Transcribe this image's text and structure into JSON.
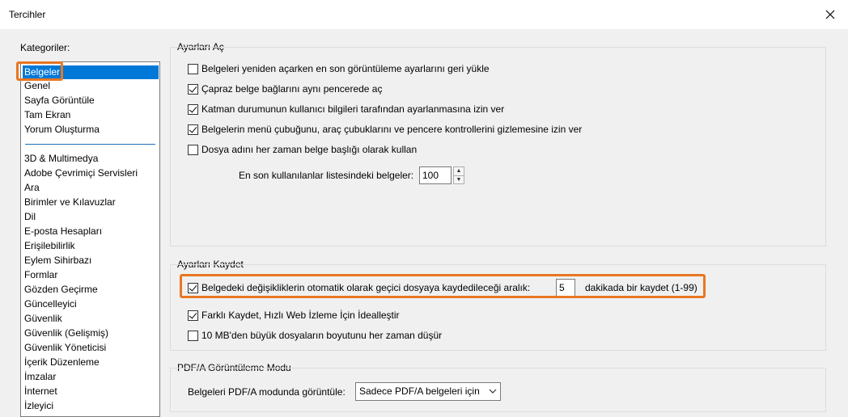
{
  "window": {
    "title": "Tercihler"
  },
  "sidebar": {
    "label": "Kategoriler:",
    "items": [
      {
        "label": "Belgeler",
        "selected": true
      },
      {
        "label": "Genel"
      },
      {
        "label": "Sayfa Görüntüle"
      },
      {
        "label": "Tam Ekran"
      },
      {
        "label": "Yorum Oluşturma"
      },
      {
        "label": "3D & Multimedya"
      },
      {
        "label": "Adobe Çevrimiçi Servisleri"
      },
      {
        "label": "Ara"
      },
      {
        "label": "Birimler ve Kılavuzlar"
      },
      {
        "label": "Dil"
      },
      {
        "label": "E-posta Hesapları"
      },
      {
        "label": "Erişilebilirlik"
      },
      {
        "label": "Eylem Sihirbazı"
      },
      {
        "label": "Formlar"
      },
      {
        "label": "Gözden Geçirme"
      },
      {
        "label": "Güncelleyici"
      },
      {
        "label": "Güvenlik"
      },
      {
        "label": "Güvenlik (Gelişmiş)"
      },
      {
        "label": "Güvenlik Yöneticisi"
      },
      {
        "label": "İçerik Düzenleme"
      },
      {
        "label": "İmzalar"
      },
      {
        "label": "İnternet"
      },
      {
        "label": "İzleyici"
      }
    ]
  },
  "open_settings": {
    "title": "Ayarları Aç",
    "options": [
      {
        "label": "Belgeleri yeniden açarken en son görüntüleme ayarlarını geri yükle",
        "checked": false
      },
      {
        "label": "Çapraz belge bağlarını aynı pencerede aç",
        "checked": true
      },
      {
        "label": "Katman durumunun kullanıcı bilgileri tarafından ayarlanmasına izin ver",
        "checked": true
      },
      {
        "label": "Belgelerin menü çubuğunu, araç çubuklarını ve pencere kontrollerini gizlemesine izin ver",
        "checked": true
      },
      {
        "label": "Dosya adını her zaman belge başlığı olarak kullan",
        "checked": false
      }
    ],
    "recent_label": "En son kullanılanlar listesindeki belgeler:",
    "recent_value": "100"
  },
  "save_settings": {
    "title": "Ayarları Kaydet",
    "autosave_label": "Belgedeki değişikliklerin otomatik olarak geçici dosyaya kaydedileceği aralık:",
    "autosave_checked": true,
    "autosave_value": "5",
    "autosave_suffix": "dakikada bir kaydet (1-99)",
    "options": [
      {
        "label": "Farklı Kaydet, Hızlı Web İzleme İçin İdealleştir",
        "checked": true
      },
      {
        "label": "10 MB'den büyük dosyaların boyutunu her zaman düşür",
        "checked": false
      }
    ]
  },
  "pdfa": {
    "title": "PDF/A Görüntüleme Modu",
    "label": "Belgeleri PDF/A modunda görüntüle:",
    "selected": "Sadece PDF/A belgeleri için"
  },
  "icons": {
    "close": "close-icon",
    "dropdown": "chevron-down-icon",
    "spin_up": "spin-up-icon",
    "spin_down": "spin-down-icon"
  },
  "colors": {
    "selection": "#0078d7",
    "highlight": "#e87722"
  }
}
